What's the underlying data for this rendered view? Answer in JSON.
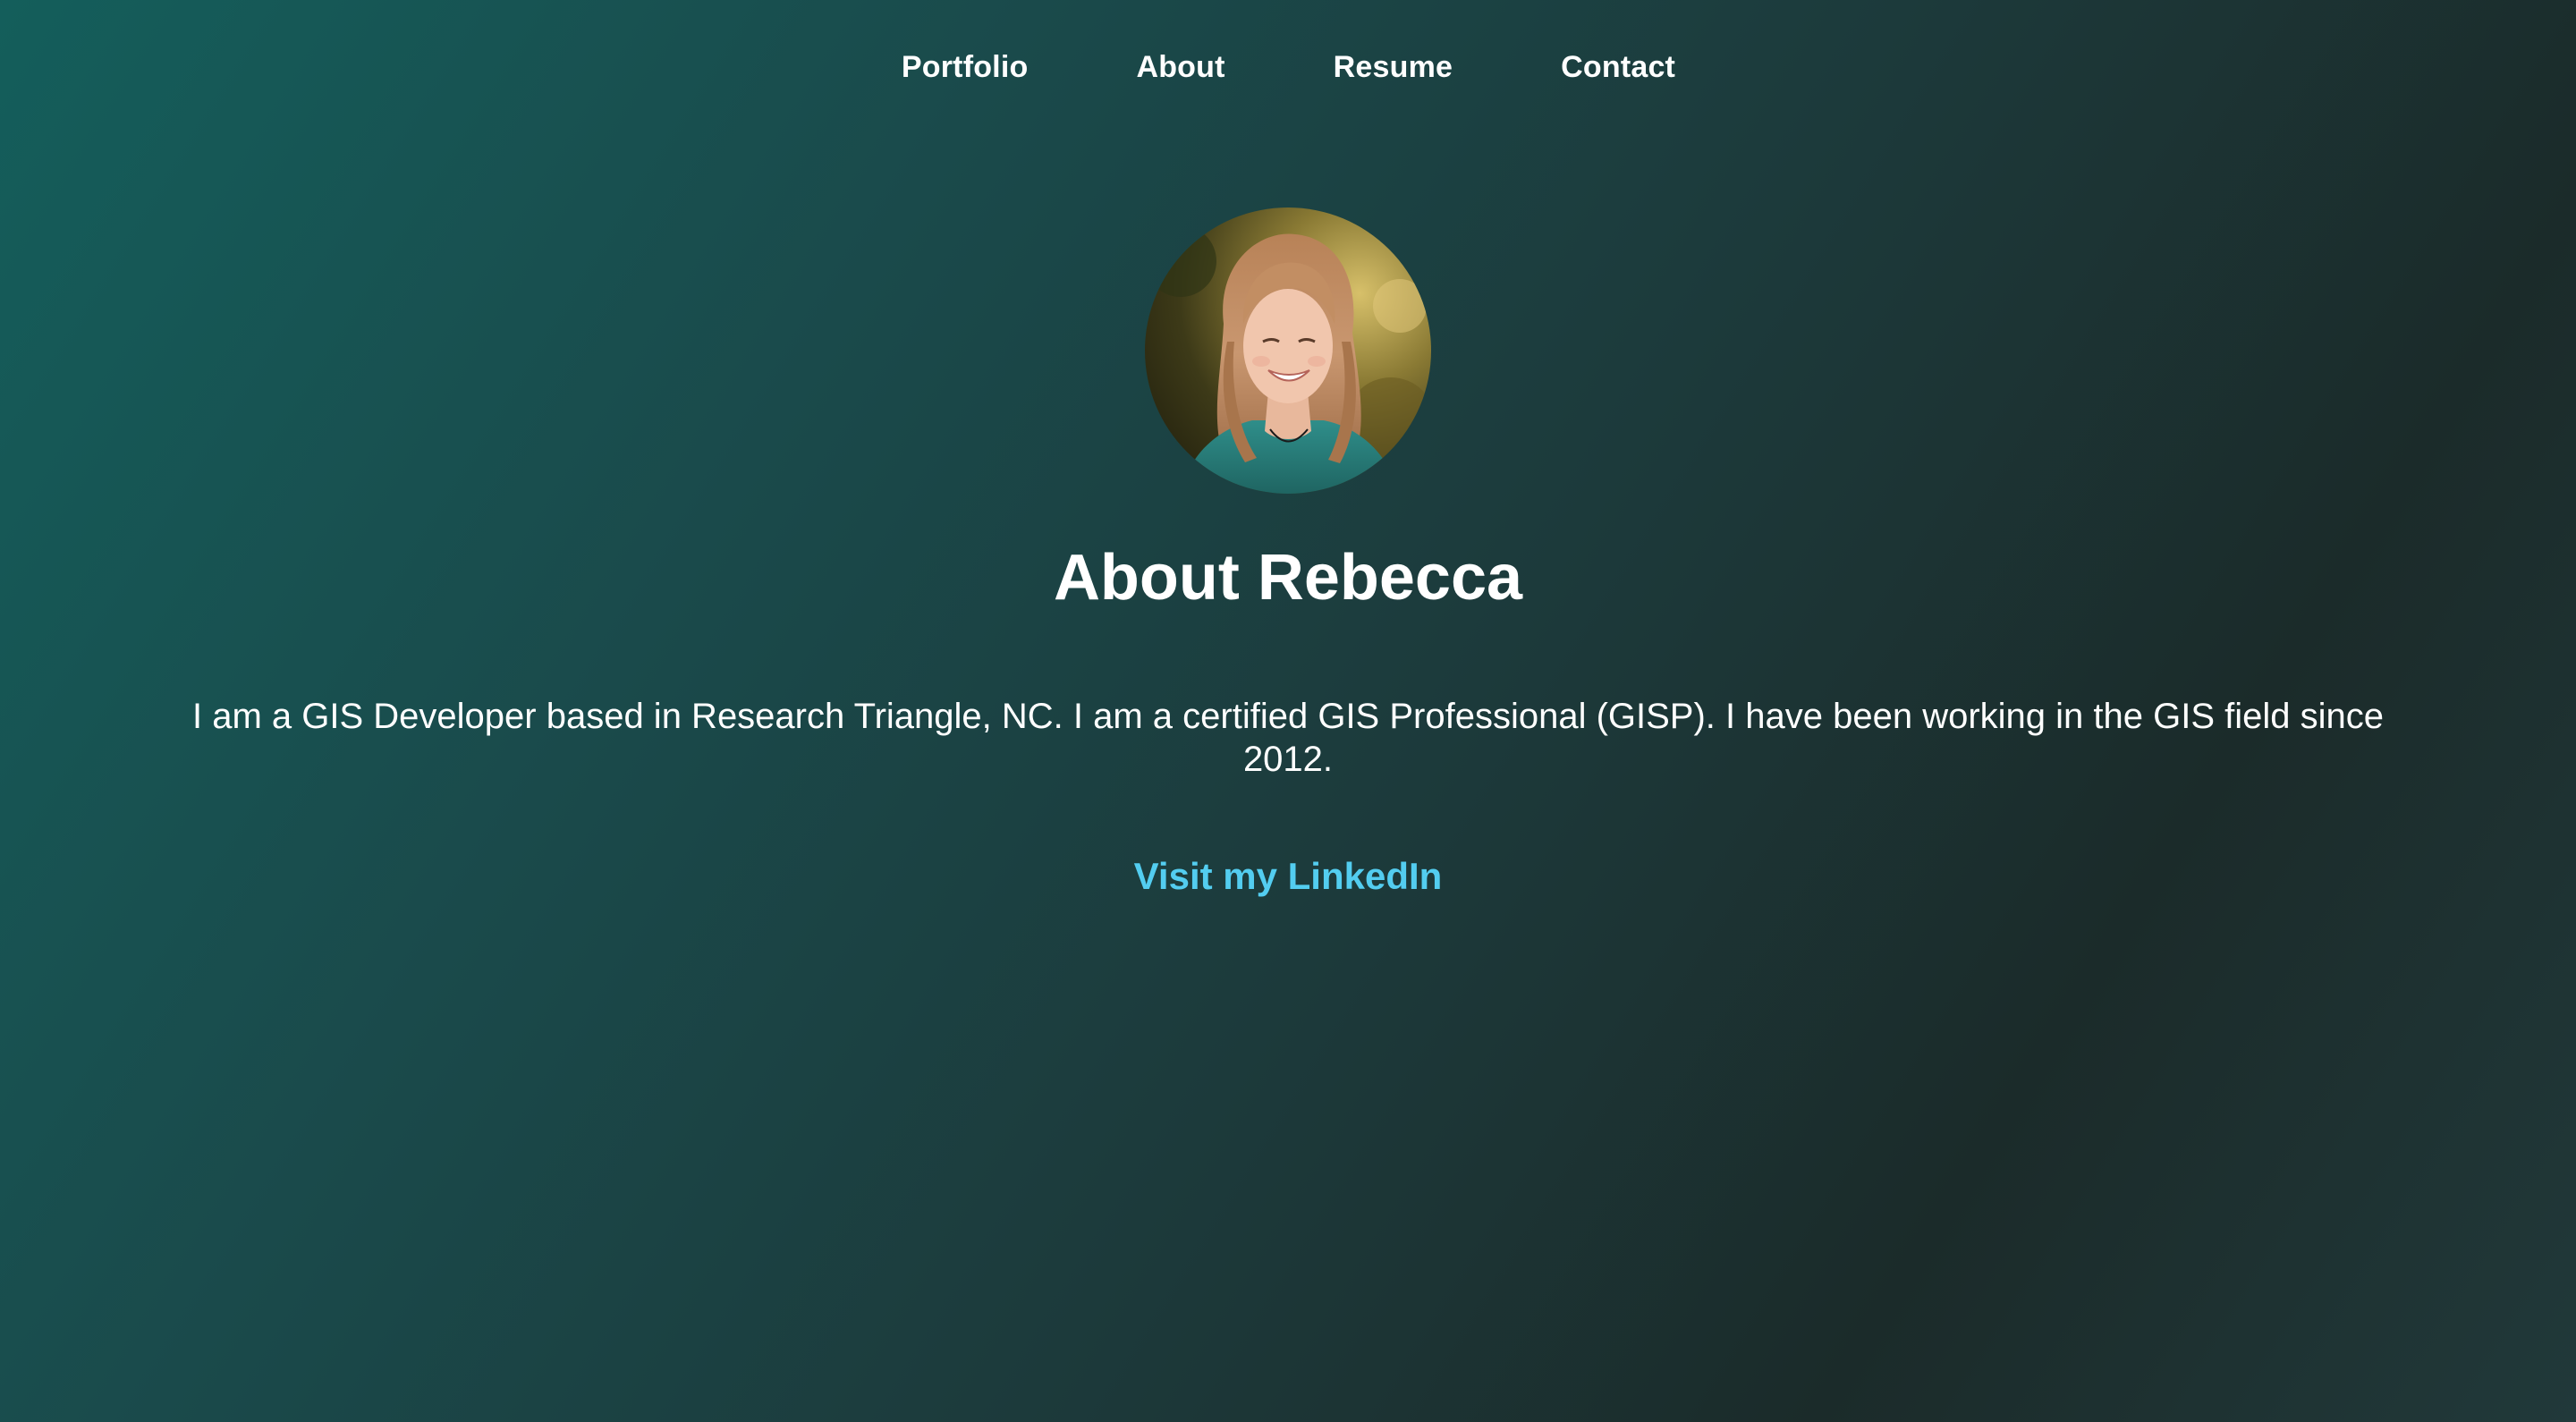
{
  "nav": {
    "items": [
      {
        "label": "Portfolio"
      },
      {
        "label": "About"
      },
      {
        "label": "Resume"
      },
      {
        "label": "Contact"
      }
    ]
  },
  "profile": {
    "photo_icon": "profile-photo"
  },
  "main": {
    "title": "About Rebecca",
    "bio": "I am a GIS Developer based in Research Triangle, NC. I am a certified GIS Professional (GISP). I have been working in the GIS field since 2012.",
    "link_label": "Visit my LinkedIn"
  },
  "colors": {
    "link": "#53cdf0",
    "background_start": "#145e5b",
    "background_end": "#1b2b2a",
    "text": "#ffffff"
  }
}
